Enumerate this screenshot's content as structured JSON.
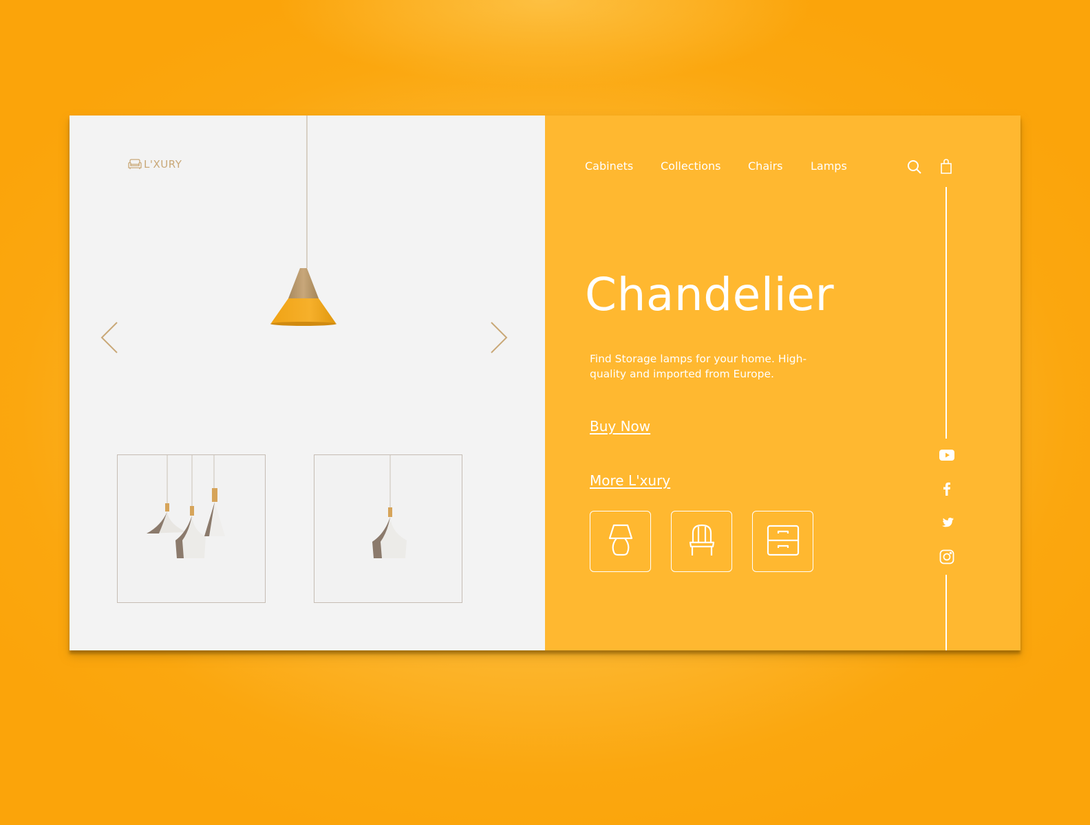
{
  "brand": {
    "name": "L'XURY",
    "logo_icon": "armchair-icon",
    "accent_color": "#c9a877"
  },
  "colors": {
    "background": "#fba70f",
    "panel_left": "#f3f3f3",
    "panel_right": "#ffb830",
    "text_light": "#ffffff"
  },
  "nav": {
    "items": [
      {
        "label": "Cabinets"
      },
      {
        "label": "Collections"
      },
      {
        "label": "Chairs"
      },
      {
        "label": "Lamps"
      }
    ],
    "search_icon": "search-icon",
    "cart_icon": "shopping-bag-icon"
  },
  "carousel": {
    "prev_icon": "chevron-left-icon",
    "next_icon": "chevron-right-icon",
    "featured_image": "orange-cone-pendant-lamp",
    "thumbnails": [
      {
        "image": "three-white-pendant-lamps"
      },
      {
        "image": "single-white-pendant-lamp"
      }
    ]
  },
  "hero": {
    "title": "Chandelier",
    "description": "Find Storage lamps for your home. High-quality and imported from Europe.",
    "buy_now": "Buy Now",
    "more": "More L'xury"
  },
  "categories": [
    {
      "name": "lamps",
      "icon": "table-lamp-icon"
    },
    {
      "name": "chairs",
      "icon": "chair-icon"
    },
    {
      "name": "cabinets",
      "icon": "drawer-cabinet-icon"
    }
  ],
  "social": [
    {
      "name": "youtube",
      "icon": "youtube-icon"
    },
    {
      "name": "facebook",
      "icon": "facebook-icon"
    },
    {
      "name": "twitter",
      "icon": "twitter-icon"
    },
    {
      "name": "instagram",
      "icon": "instagram-icon"
    }
  ]
}
